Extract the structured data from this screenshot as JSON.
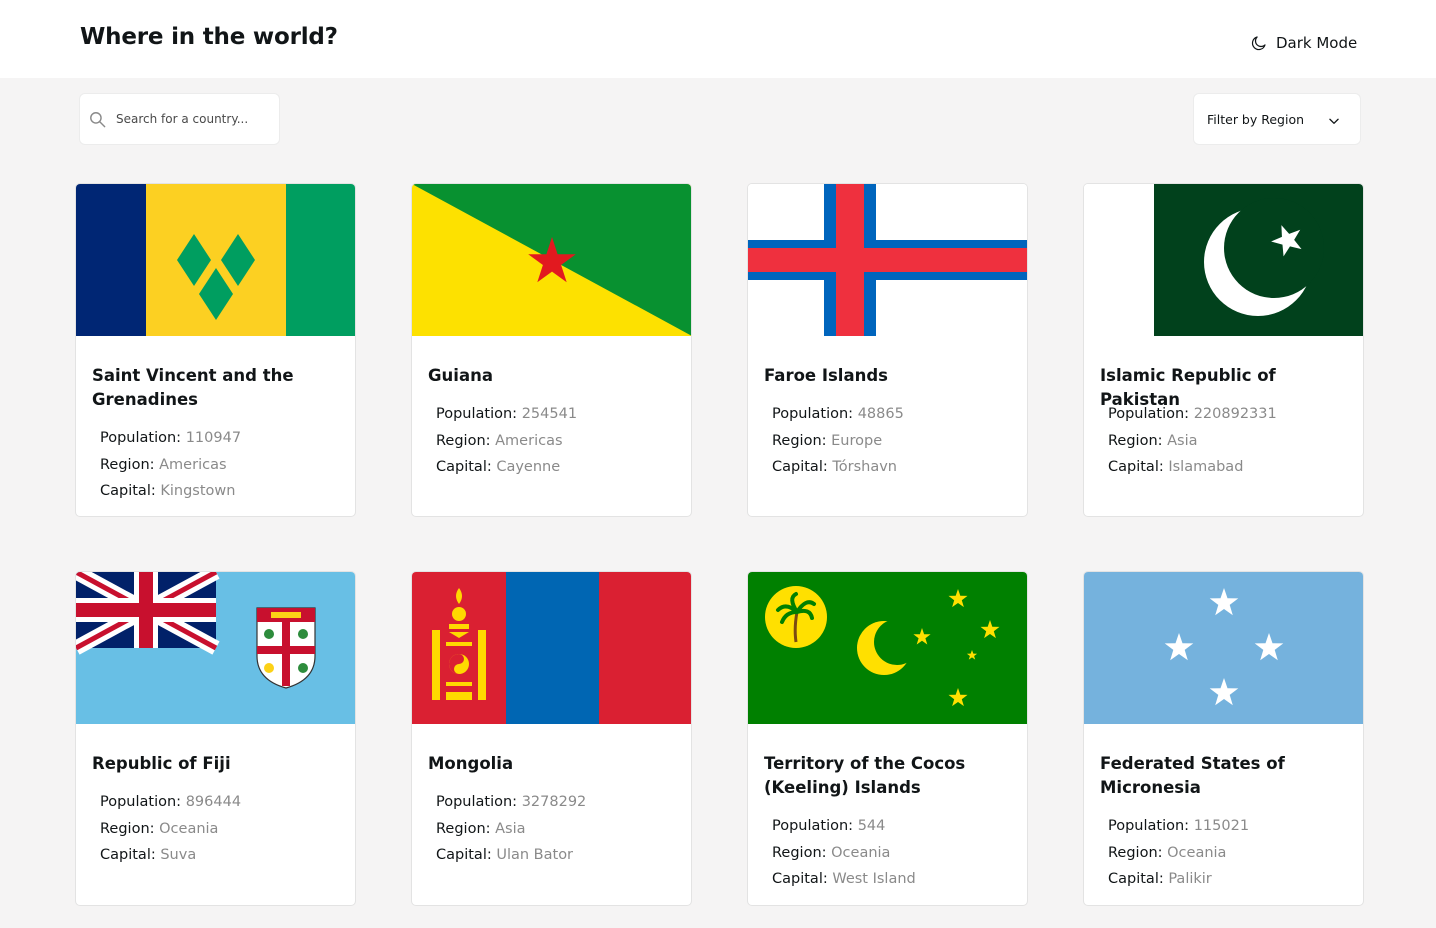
{
  "header": {
    "title": "Where in the world?",
    "theme_toggle_label": "Dark Mode",
    "theme_toggle_icon": "moon-icon"
  },
  "search": {
    "placeholder": "Search for a country...",
    "value": "",
    "icon": "search-icon"
  },
  "filter": {
    "label": "Filter by Region",
    "icon": "chevron-down-icon"
  },
  "labels": {
    "population": "Population:",
    "region": "Region:",
    "capital": "Capital:"
  },
  "colors": {
    "background": "#f5f4f4",
    "card": "#ffffff",
    "text": "#111517",
    "value_text": "#8a8a8a"
  },
  "countries": [
    {
      "name": "Saint Vincent and the Grenadines",
      "population": "110947",
      "region": "Americas",
      "capital": "Kingstown",
      "flag": "saint-vincent-flag"
    },
    {
      "name": "Guiana",
      "population": "254541",
      "region": "Americas",
      "capital": "Cayenne",
      "flag": "french-guiana-flag"
    },
    {
      "name": "Faroe Islands",
      "population": "48865",
      "region": "Europe",
      "capital": "Tórshavn",
      "flag": "faroe-islands-flag"
    },
    {
      "name": "Islamic Republic of Pakistan",
      "population": "220892331",
      "region": "Asia",
      "capital": "Islamabad",
      "flag": "pakistan-flag"
    },
    {
      "name": "Republic of Fiji",
      "population": "896444",
      "region": "Oceania",
      "capital": "Suva",
      "flag": "fiji-flag"
    },
    {
      "name": "Mongolia",
      "population": "3278292",
      "region": "Asia",
      "capital": "Ulan Bator",
      "flag": "mongolia-flag"
    },
    {
      "name": "Territory of the Cocos (Keeling) Islands",
      "population": "544",
      "region": "Oceania",
      "capital": "West Island",
      "flag": "cocos-islands-flag"
    },
    {
      "name": "Federated States of Micronesia",
      "population": "115021",
      "region": "Oceania",
      "capital": "Palikir",
      "flag": "micronesia-flag"
    }
  ]
}
